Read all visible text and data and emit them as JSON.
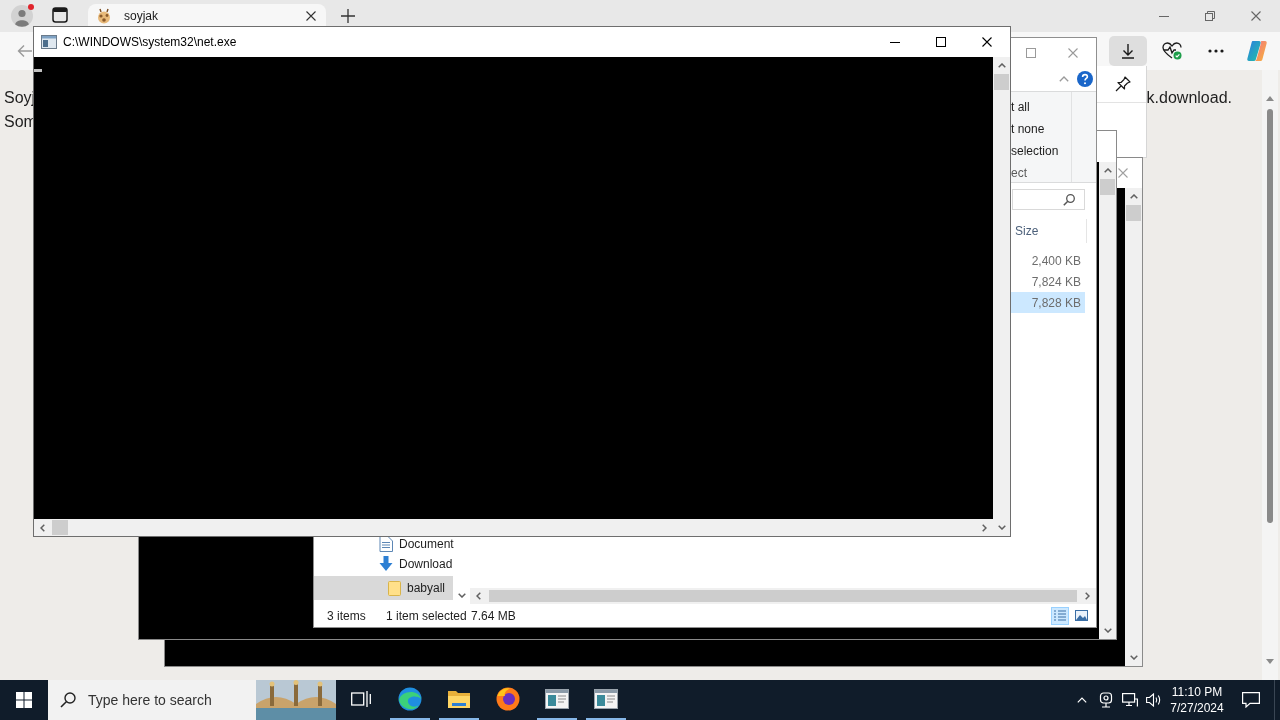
{
  "browser": {
    "tabs": [
      {
        "title": "soyjak",
        "selected": true
      }
    ],
    "page_lines": [
      {
        "left": "Soyj",
        "right": "k.download."
      },
      {
        "left": "Som"
      }
    ]
  },
  "console": {
    "title": "C:\\WINDOWS\\system32\\net.exe"
  },
  "explorer": {
    "ribbon_commands": [
      "t all",
      "t none",
      "selection"
    ],
    "ribbon_group": "ect",
    "columns": [
      "Size"
    ],
    "rows": [
      {
        "size": "2,400 KB",
        "selected": false
      },
      {
        "size": "7,824 KB",
        "selected": false
      },
      {
        "size": "7,828 KB",
        "selected": true
      }
    ],
    "nav": [
      {
        "label": "Document",
        "kind": "documents",
        "selected": false
      },
      {
        "label": "Download",
        "kind": "downloads",
        "selected": false,
        "children": [
          {
            "label": "babyall",
            "kind": "folder",
            "selected": true
          }
        ]
      }
    ],
    "status": {
      "items": "3 items",
      "selection": "1 item selected",
      "size": "7.64 MB"
    },
    "views": [
      {
        "kind": "details",
        "selected": true
      },
      {
        "kind": "large_icons",
        "selected": false
      }
    ]
  },
  "taskbar": {
    "search": {
      "placeholder": "Type here to search"
    },
    "apps": [
      {
        "kind": "task_view",
        "running": false
      },
      {
        "kind": "edge",
        "running": true
      },
      {
        "kind": "explorer",
        "running": true
      },
      {
        "kind": "firefox",
        "running": false
      },
      {
        "kind": "window_app",
        "running": true
      },
      {
        "kind": "window_app",
        "running": true
      }
    ],
    "clock": {
      "time": "11:10 PM",
      "date": "7/27/2024"
    }
  }
}
